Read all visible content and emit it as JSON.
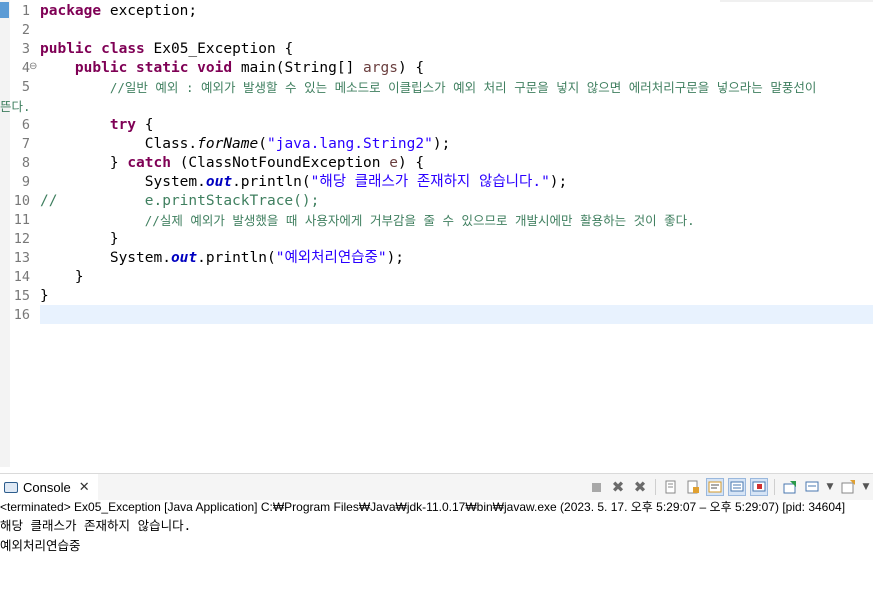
{
  "editor": {
    "lines": [
      {
        "num": "1",
        "parts": [
          [
            "kw",
            "package"
          ],
          [
            "p",
            " exception;"
          ]
        ]
      },
      {
        "num": "2",
        "parts": []
      },
      {
        "num": "3",
        "parts": [
          [
            "kw",
            "public"
          ],
          [
            "p",
            " "
          ],
          [
            "kw",
            "class"
          ],
          [
            "p",
            " Ex05_Exception {"
          ]
        ]
      },
      {
        "num": "4",
        "fold": true,
        "parts": [
          [
            "p",
            "    "
          ],
          [
            "kw",
            "public"
          ],
          [
            "p",
            " "
          ],
          [
            "kw",
            "static"
          ],
          [
            "p",
            " "
          ],
          [
            "kw",
            "void"
          ],
          [
            "p",
            " main(String[] "
          ],
          [
            "param",
            "args"
          ],
          [
            "p",
            ") {"
          ]
        ]
      },
      {
        "num": "5",
        "parts": [
          [
            "p",
            "        "
          ],
          [
            "cmt",
            "//일반 예외 : 예외가 발생할 수 있는 메소드로 이클립스가 예외 처리 구문을 넣지 않으면 에러처리구문을 넣으라는 말풍선이"
          ]
        ]
      },
      {
        "num": "",
        "wrap": true,
        "parts": [
          [
            "cmt",
            "뜬다."
          ]
        ]
      },
      {
        "num": "6",
        "parts": [
          [
            "p",
            "        "
          ],
          [
            "kw",
            "try"
          ],
          [
            "p",
            " {"
          ]
        ]
      },
      {
        "num": "7",
        "parts": [
          [
            "p",
            "            Class."
          ],
          [
            "sm",
            "forName"
          ],
          [
            "p",
            "("
          ],
          [
            "str",
            "\"java.lang.String2\""
          ],
          [
            "p",
            ");"
          ]
        ]
      },
      {
        "num": "8",
        "parts": [
          [
            "p",
            "        } "
          ],
          [
            "kw",
            "catch"
          ],
          [
            "p",
            " (ClassNotFoundException "
          ],
          [
            "param",
            "e"
          ],
          [
            "p",
            ") {"
          ]
        ]
      },
      {
        "num": "9",
        "parts": [
          [
            "p",
            "            System."
          ],
          [
            "fld",
            "out"
          ],
          [
            "p",
            ".println("
          ],
          [
            "str",
            "\"해당 클래스가 존재하지 않습니다.\""
          ],
          [
            "p",
            ");"
          ]
        ]
      },
      {
        "num": "10",
        "parts": [
          [
            "cmt",
            "//          e.printStackTrace();"
          ]
        ]
      },
      {
        "num": "11",
        "parts": [
          [
            "p",
            "            "
          ],
          [
            "cmt",
            "//실제 예외가 발생했을 때 사용자에게 거부감을 줄 수 있으므로 개발시에만 활용하는 것이 좋다."
          ]
        ]
      },
      {
        "num": "12",
        "parts": [
          [
            "p",
            "        }"
          ]
        ]
      },
      {
        "num": "13",
        "parts": [
          [
            "p",
            "        System."
          ],
          [
            "fld",
            "out"
          ],
          [
            "p",
            ".println("
          ],
          [
            "str",
            "\"예외처리연습중\""
          ],
          [
            "p",
            ");"
          ]
        ]
      },
      {
        "num": "14",
        "parts": [
          [
            "p",
            "    }"
          ]
        ]
      },
      {
        "num": "15",
        "parts": [
          [
            "p",
            "}"
          ]
        ]
      },
      {
        "num": "16",
        "parts": []
      }
    ]
  },
  "console": {
    "tab_label": "Console",
    "status": "<terminated> Ex05_Exception [Java Application] C:₩Program Files₩Java₩jdk-11.0.17₩bin₩javaw.exe  (2023. 5. 17. 오후 5:29:07 – 오후 5:29:07) [pid: 34604]",
    "output": [
      "해당 클래스가 존재하지 않습니다.",
      "예외처리연습중"
    ],
    "toolbar_icons": [
      "terminate-icon",
      "remove-launch-icon",
      "remove-all-terminated-icon",
      "clear-console-icon",
      "scroll-lock-icon",
      "word-wrap-icon",
      "show-on-stdout-icon",
      "show-on-stderr-icon",
      "pin-console-icon",
      "display-selected-console-icon",
      "open-console-icon"
    ]
  }
}
